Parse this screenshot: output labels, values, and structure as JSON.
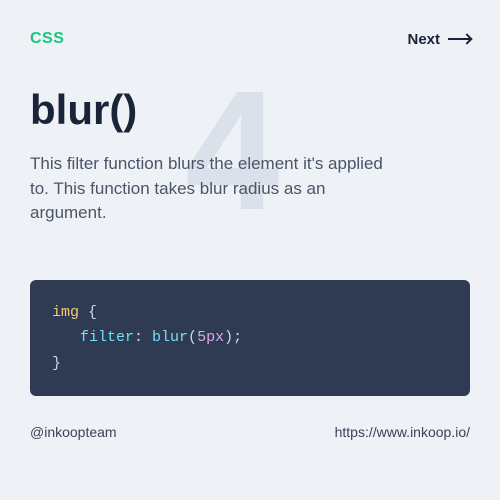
{
  "header": {
    "badge": "CSS",
    "next_label": "Next"
  },
  "main": {
    "background_number": "4",
    "title": "blur()",
    "description": "This filter function blurs the element it's applied to. This function takes blur radius as an argument.",
    "code": {
      "selector": "img",
      "property": "filter",
      "function": "blur",
      "value": "5px"
    }
  },
  "footer": {
    "handle": "@inkoopteam",
    "url": "https://www.inkoop.io/"
  }
}
